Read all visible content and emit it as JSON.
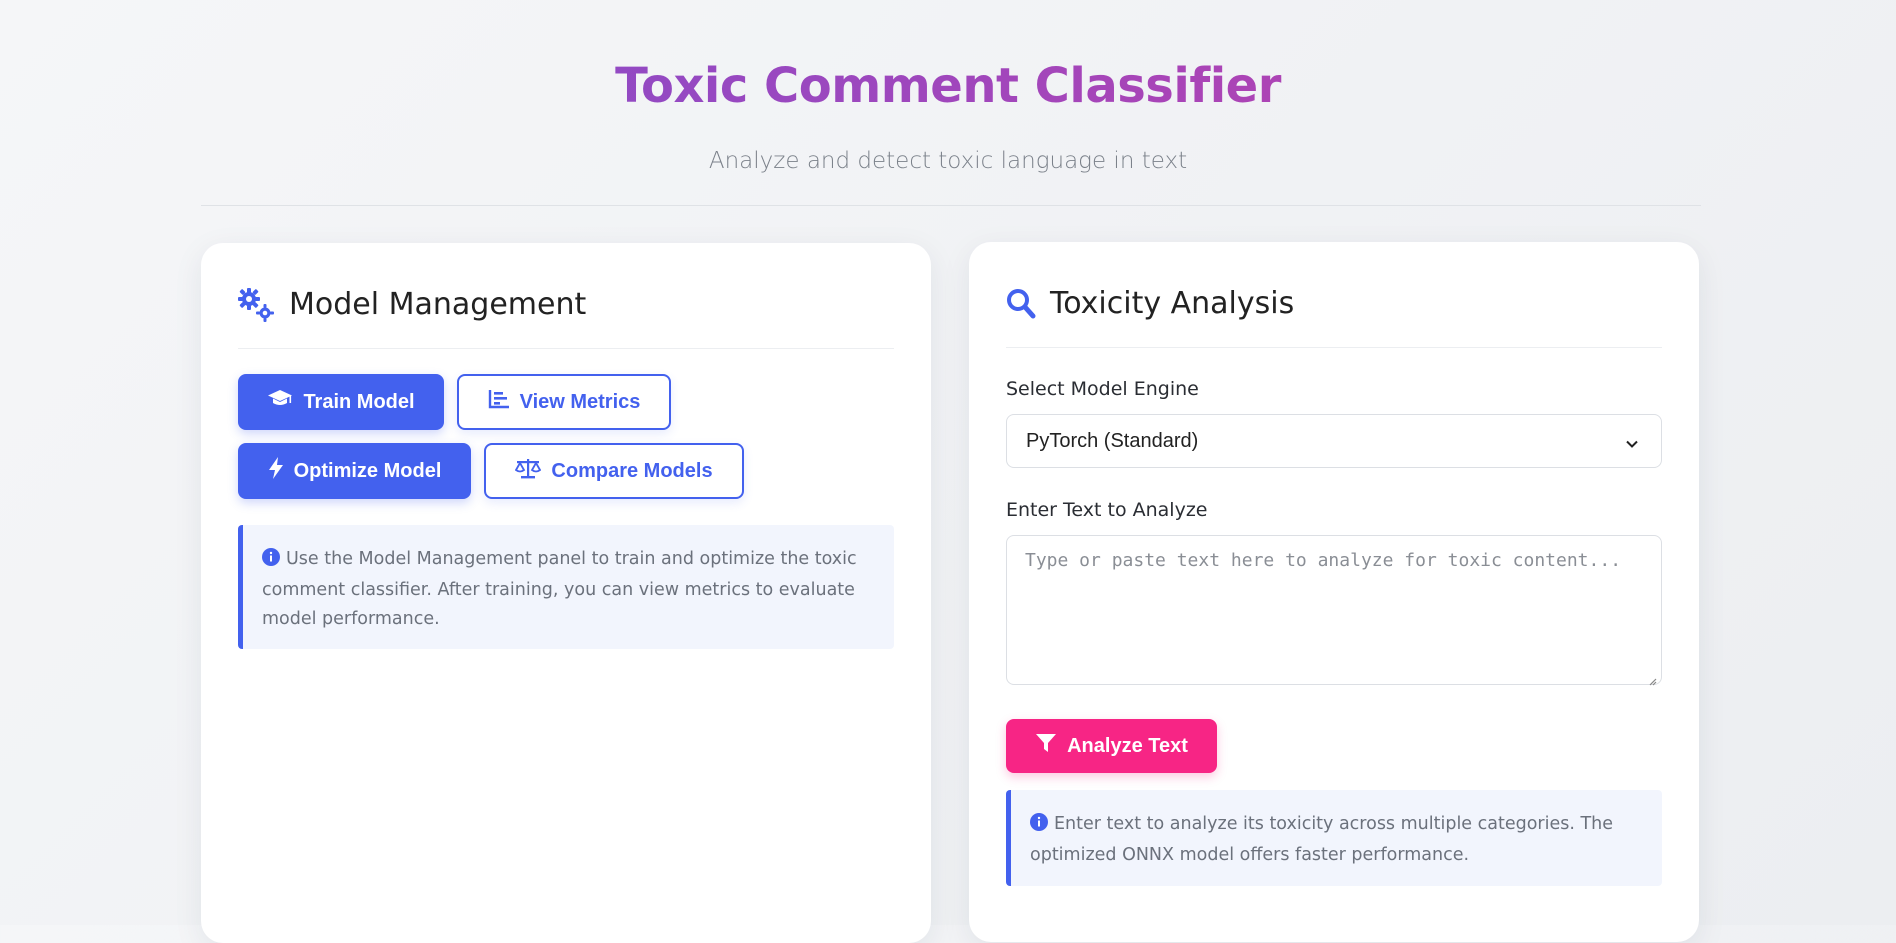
{
  "header": {
    "title": "Toxic Comment Classifier",
    "subtitle": "Analyze and detect toxic language in text"
  },
  "model_panel": {
    "title": "Model Management",
    "icon": "gears-icon",
    "buttons": {
      "train": "Train Model",
      "metrics": "View Metrics",
      "optimize": "Optimize Model",
      "compare": "Compare Models"
    },
    "info": "Use the Model Management panel to train and optimize the toxic comment classifier. After training, you can view metrics to evaluate model performance."
  },
  "analysis_panel": {
    "title": "Toxicity Analysis",
    "icon": "search-icon",
    "engine_label": "Select Model Engine",
    "engine_value": "PyTorch (Standard)",
    "text_label": "Enter Text to Analyze",
    "text_placeholder": "Type or paste text here to analyze for toxic content...",
    "analyze_button": "Analyze Text",
    "info": "Enter text to analyze its toxicity across multiple categories. The optimized ONNX model offers faster performance."
  },
  "colors": {
    "primary": "#4361ee",
    "accent": "#f72585",
    "title_gradient_start": "#7b4fd0",
    "title_gradient_end": "#c43ea8"
  }
}
